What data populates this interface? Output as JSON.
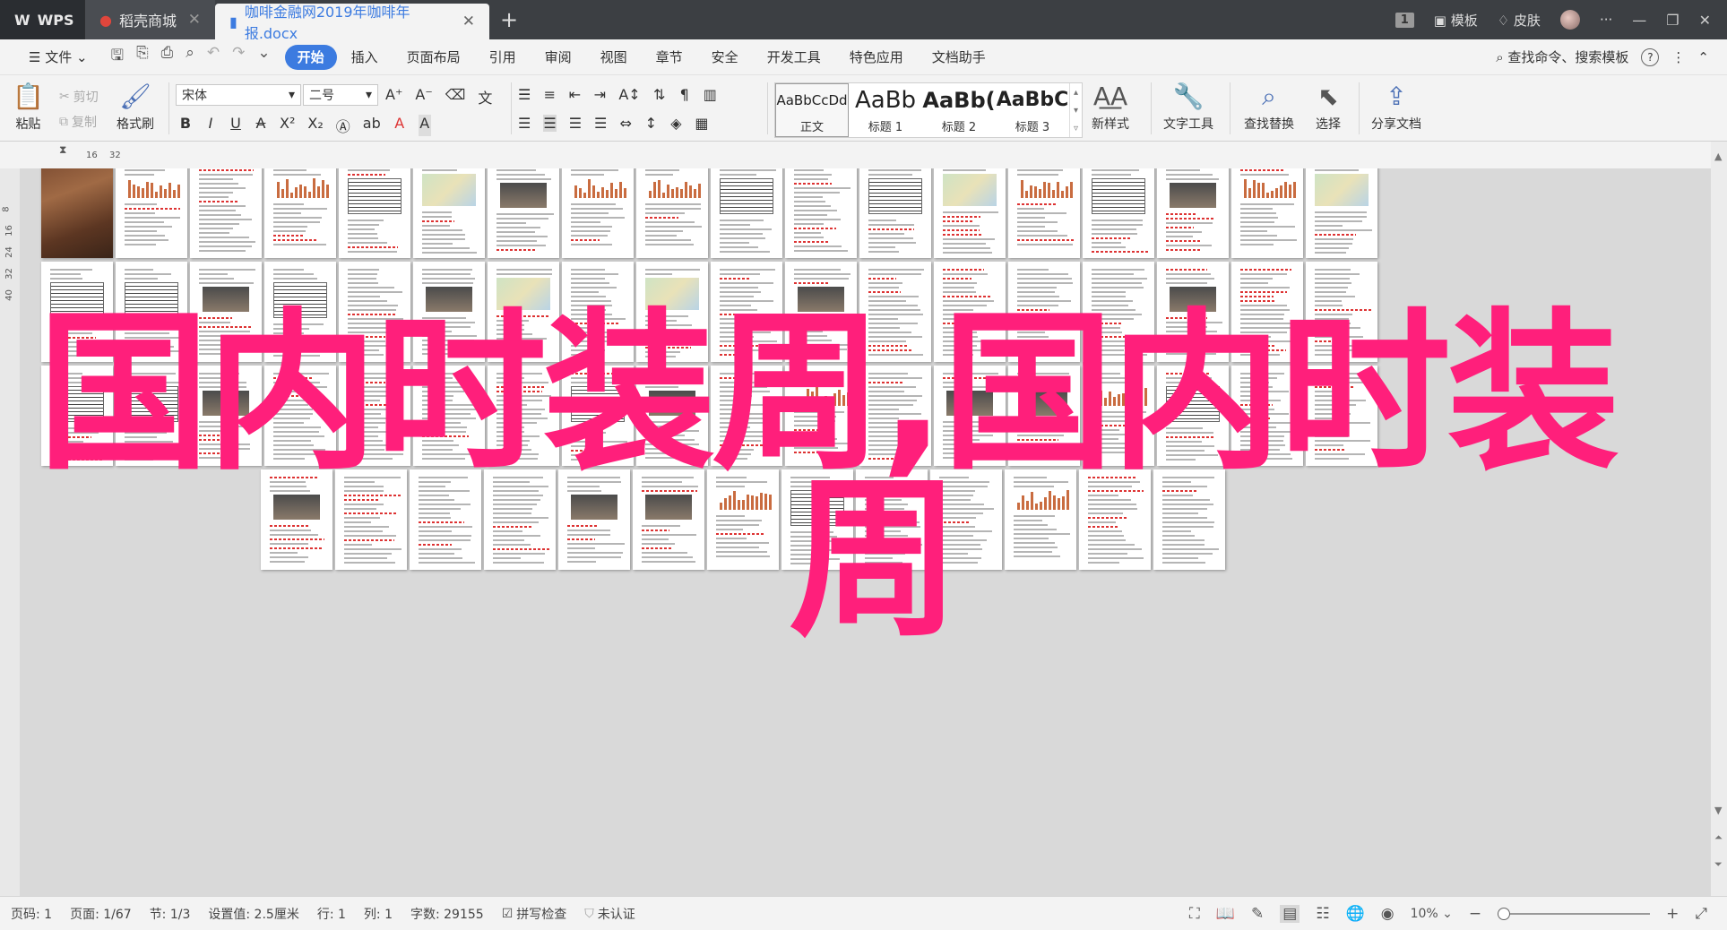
{
  "titlebar": {
    "tabs": [
      {
        "label": "WPS",
        "icon": "wps-logo-icon"
      },
      {
        "label": "稻壳商城",
        "icon": "docer-icon"
      },
      {
        "label": "咖啡金融网2019年咖啡年报.docx",
        "icon": "word-doc-icon"
      }
    ],
    "new_tab": "+",
    "badge": "1",
    "templates": "模板",
    "skins": "皮肤",
    "more": "···"
  },
  "menubar": {
    "file": "文件",
    "items": [
      "开始",
      "插入",
      "页面布局",
      "引用",
      "审阅",
      "视图",
      "章节",
      "安全",
      "开发工具",
      "特色应用",
      "文档助手"
    ],
    "active": "开始",
    "search": "查找命令、搜索模板",
    "help": "?"
  },
  "ribbon": {
    "paste": "粘贴",
    "cut": "剪切",
    "copy": "复制",
    "format_painter": "格式刷",
    "font_name": "宋体",
    "font_size": "二号",
    "styles": [
      {
        "sample": "AaBbCcDd",
        "name": "正文"
      },
      {
        "sample": "AaBb",
        "name": "标题 1"
      },
      {
        "sample": "AaBb(",
        "name": "标题 2"
      },
      {
        "sample": "AaBbC",
        "name": "标题 3"
      }
    ],
    "new_style": "新样式",
    "text_tools": "文字工具",
    "find_replace": "查找替换",
    "select": "选择",
    "share": "分享文档"
  },
  "ruler": {
    "h_marks": [
      "16",
      "32"
    ],
    "v_marks": [
      "8",
      "16",
      "24",
      "32",
      "40"
    ]
  },
  "overlay": {
    "line1": "国内时装周,国内时装",
    "line2": "周"
  },
  "statusbar": {
    "page_no": "页码: 1",
    "page": "页面: 1/67",
    "section": "节: 1/3",
    "setting": "设置值: 2.5厘米",
    "row": "行: 1",
    "col": "列: 1",
    "words": "字数: 29155",
    "spell": "拼写检查",
    "auth": "未认证",
    "zoom": "10%",
    "zoom_level": 0.1
  },
  "colors": {
    "accent": "#3c7be0",
    "overlay": "#ff1f7b",
    "titlebar": "#3c3f43"
  }
}
